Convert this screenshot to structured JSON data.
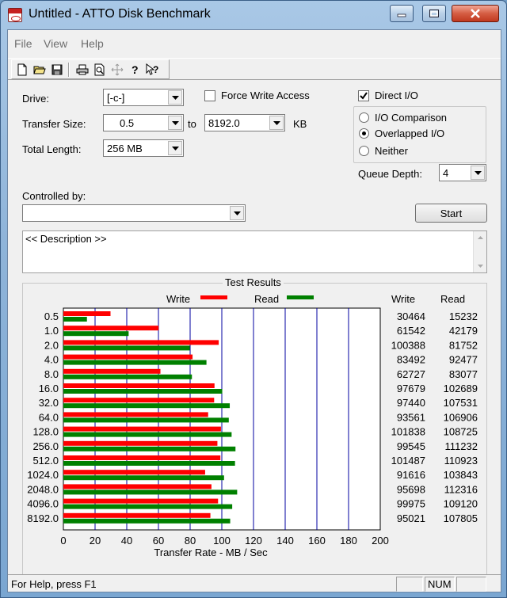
{
  "window": {
    "title": "Untitled - ATTO Disk Benchmark"
  },
  "menu": {
    "items": [
      "File",
      "View",
      "Help"
    ]
  },
  "toolbar": {
    "buttons": [
      "new-icon",
      "open-icon",
      "save-icon",
      "print-icon",
      "print-preview-icon",
      "move-icon",
      "help-icon",
      "context-help-icon"
    ]
  },
  "form": {
    "drive_label": "Drive:",
    "drive_value": "[-c-]",
    "transfer_size_label": "Transfer Size:",
    "transfer_from": "0.5",
    "to_label": "to",
    "transfer_to": "8192.0",
    "kb_label": "KB",
    "total_length_label": "Total Length:",
    "total_length_value": "256 MB",
    "force_write_label": "Force Write Access",
    "force_write_checked": false,
    "direct_io_label": "Direct I/O",
    "direct_io_checked": true,
    "radio_options": [
      "I/O Comparison",
      "Overlapped I/O",
      "Neither"
    ],
    "radio_selected": 1,
    "queue_depth_label": "Queue Depth:",
    "queue_depth_value": "4",
    "controlled_by_label": "Controlled by:",
    "controlled_by_value": "",
    "start_label": "Start",
    "description": "<< Description >>"
  },
  "results": {
    "title": "Test Results",
    "write_legend": "Write",
    "read_legend": "Read",
    "write_header": "Write",
    "read_header": "Read",
    "write_color": "#ff0000",
    "read_color": "#008000"
  },
  "chart_data": {
    "type": "bar",
    "orientation": "horizontal",
    "categories": [
      "0.5",
      "1.0",
      "2.0",
      "4.0",
      "8.0",
      "16.0",
      "32.0",
      "64.0",
      "128.0",
      "256.0",
      "512.0",
      "1024.0",
      "2048.0",
      "4096.0",
      "8192.0"
    ],
    "series": [
      {
        "name": "Write",
        "values": [
          30464,
          61542,
          100388,
          83492,
          62727,
          97679,
          97440,
          93561,
          101838,
          99545,
          101487,
          91616,
          95698,
          99975,
          95021
        ]
      },
      {
        "name": "Read",
        "values": [
          15232,
          42179,
          81752,
          92477,
          83077,
          102689,
          107531,
          106906,
          108725,
          111232,
          110923,
          103843,
          112316,
          109120,
          107805
        ]
      }
    ],
    "xlabel": "Transfer Rate - MB / Sec",
    "xticks": [
      "0",
      "20",
      "40",
      "60",
      "80",
      "100",
      "120",
      "140",
      "160",
      "180",
      "200"
    ],
    "xlim": [
      0,
      200
    ],
    "grid": true,
    "legend_placement": "top"
  },
  "status": {
    "help": "For Help, press F1",
    "num": "NUM"
  }
}
